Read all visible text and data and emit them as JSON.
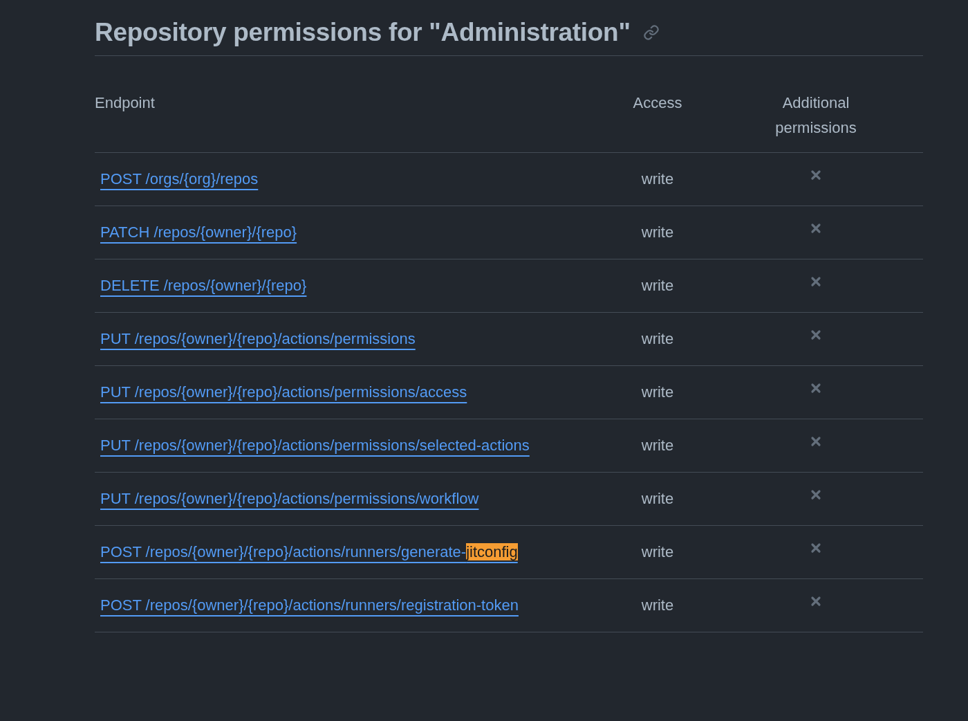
{
  "heading": "Repository permissions for \"Administration\"",
  "table": {
    "columns": [
      "Endpoint",
      "Access",
      "Additional permissions"
    ],
    "rows": [
      {
        "endpoint": "POST /orgs/{org}/repos",
        "access": "write",
        "additional_permissions": false
      },
      {
        "endpoint": "PATCH /repos/{owner}/{repo}",
        "access": "write",
        "additional_permissions": false
      },
      {
        "endpoint": "DELETE /repos/{owner}/{repo}",
        "access": "write",
        "additional_permissions": false
      },
      {
        "endpoint": "PUT /repos/{owner}/{repo}/actions/permissions",
        "access": "write",
        "additional_permissions": false
      },
      {
        "endpoint": "PUT /repos/{owner}/{repo}/actions/permissions/access",
        "access": "write",
        "additional_permissions": false
      },
      {
        "endpoint": "PUT /repos/{owner}/{repo}/actions/permissions/selected-actions",
        "access": "write",
        "additional_permissions": false
      },
      {
        "endpoint": "PUT /repos/{owner}/{repo}/actions/permissions/workflow",
        "access": "write",
        "additional_permissions": false
      },
      {
        "endpoint": "POST /repos/{owner}/{repo}/actions/runners/generate-",
        "highlight": "jitconfig",
        "access": "write",
        "additional_permissions": false
      },
      {
        "endpoint": "POST /repos/{owner}/{repo}/actions/runners/registration-token",
        "access": "write",
        "additional_permissions": false
      }
    ]
  }
}
